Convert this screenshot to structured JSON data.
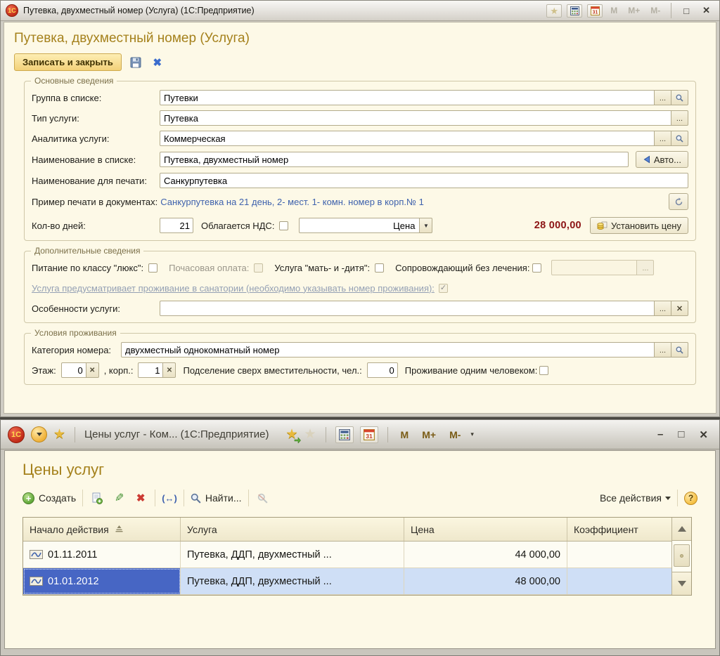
{
  "glyphs": {
    "logo": "1С",
    "star": "★",
    "maximize": "□",
    "minimize": "–",
    "close": "✕",
    "blue_close": "✖",
    "ellipsis": "...",
    "dropdown": "▼",
    "clear_x": "✕",
    "check": "✓",
    "plus": "+",
    "pencil": "✎",
    "delete_x": "✖",
    "interval": "(↔)",
    "overflow": "▾",
    "calendar_day": "31"
  },
  "top_window": {
    "titlebar": {
      "title": "Путевка, двухместный номер (Услуга)  (1С:Предприятие)",
      "m_buttons": [
        "M",
        "M+",
        "M-"
      ]
    },
    "page_title": "Путевка, двухместный номер (Услуга)",
    "commands": {
      "save_and_close": "Записать и закрыть"
    },
    "main_section": {
      "legend": "Основные сведения",
      "group_label": "Группа в списке:",
      "group_value": "Путевки",
      "type_label": "Тип услуги:",
      "type_value": "Путевка",
      "analytics_label": "Аналитика услуги:",
      "analytics_value": "Коммерческая",
      "list_name_label": "Наименование в списке:",
      "list_name_value": "Путевка, двухместный номер",
      "auto_button": "Авто...",
      "print_name_label": "Наименование для печати:",
      "print_name_value": "Санкурпутевка",
      "print_example_label": "Пример печати в документах:",
      "print_example_value": "Санкурпутевка на 21 день, 2- мест. 1- комн. номер в корп.№ 1",
      "days_label": "Кол-во дней:",
      "days_value": "21",
      "vat_label": "Облагается НДС:",
      "price_kind_value": "Цена",
      "price_value": "28 000,00",
      "set_price_button": "Установить цену"
    },
    "additional_section": {
      "legend": "Дополнительные сведения",
      "lux_label": "Питание по классу \"люкс\":",
      "hourly_label": "Почасовая оплата:",
      "mother_child_label": "Услуга \"мать- и -дитя\":",
      "escort_label": "Сопровождающий без лечения:",
      "sanatorium_link": "Услуга предусматривает проживание в санатории (необходимо указывать номер проживания):",
      "features_label": "Особенности услуги:"
    },
    "accommodation_section": {
      "legend": "Условия проживания",
      "category_label": "Категория номера:",
      "category_value": "двухместный однокомнатный номер",
      "floor_label": "Этаж:",
      "floor_value": "0",
      "building_label": ", корп.:",
      "building_value": "1",
      "extra_label": "Подселение сверх вместительности, чел.:",
      "extra_value": "0",
      "single_label": "Проживание одним человеком:"
    }
  },
  "bottom_window": {
    "titlebar": {
      "title": "Цены услуг - Ком...  (1С:Предприятие)",
      "m_buttons": [
        "M",
        "M+",
        "M-"
      ]
    },
    "page_title": "Цены услуг",
    "toolbar": {
      "create": "Создать",
      "find": "Найти...",
      "all_actions": "Все действия",
      "help": "?"
    },
    "table": {
      "columns": [
        "Начало действия",
        "Услуга",
        "Цена",
        "Коэффициент"
      ],
      "rows": [
        {
          "date": "01.11.2011",
          "service": "Путевка, ДДП, двухместный ...",
          "price": "44 000,00",
          "coefficient": ""
        },
        {
          "date": "01.01.2012",
          "service": "Путевка, ДДП, двухместный ...",
          "price": "48 000,00",
          "coefficient": ""
        }
      ]
    }
  }
}
